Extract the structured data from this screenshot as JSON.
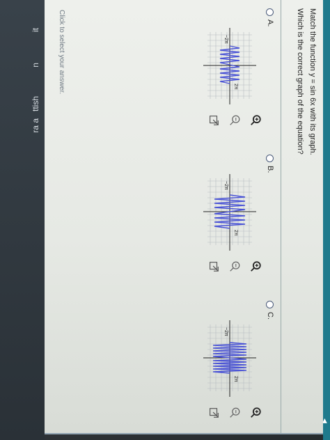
{
  "question": {
    "prompt": "Match the function y = sin 6x with its graph.",
    "subprompt": "Which is the correct graph of the equation?"
  },
  "options": [
    {
      "label": "A.",
      "x_tick": "2π",
      "neg_tick": "−2π"
    },
    {
      "label": "B.",
      "x_tick": "2π",
      "neg_tick": "−2π"
    },
    {
      "label": "C.",
      "x_tick": "2π",
      "neg_tick": "−2π"
    }
  ],
  "footer": {
    "hint": "Click to select your answer."
  },
  "sidebar_fragments": [
    "ra a",
    "ttish",
    "n",
    "it"
  ],
  "icons": {
    "zoom_in": "magnifier-plus-icon",
    "zoom_out": "magnifier-minus-icon",
    "open_new": "external-link-icon",
    "back": "triangle-left-icon"
  },
  "colors": {
    "curve": "#4a53d6",
    "accent": "#1f7a8c"
  }
}
